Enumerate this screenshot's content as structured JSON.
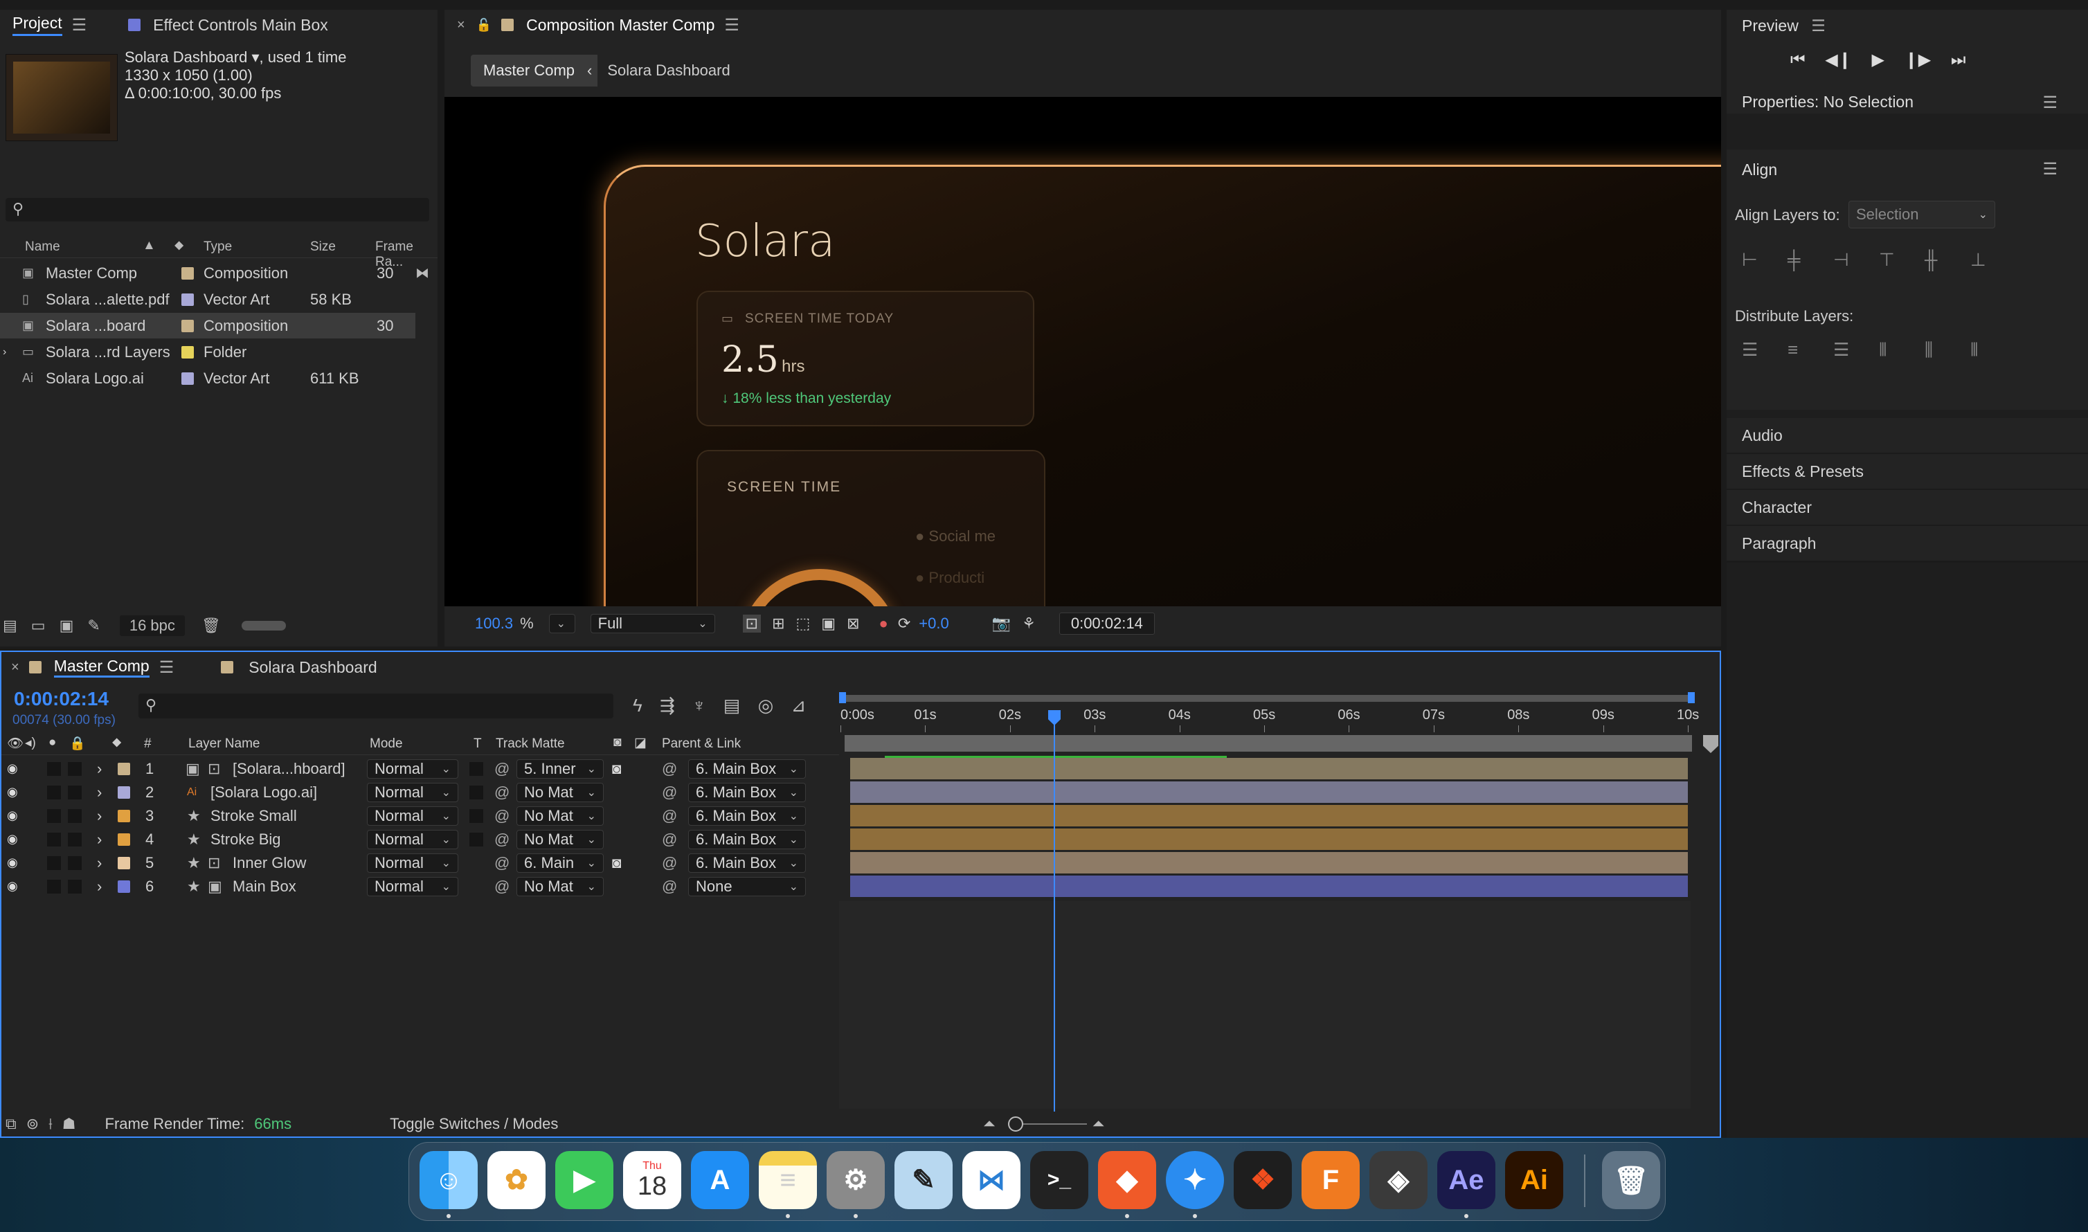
{
  "project_panel": {
    "tab_project": "Project",
    "tab_effects": "Effect Controls Main Box",
    "preview_name": "Solara Dashboard ▾",
    "preview_used": ", used 1 time",
    "preview_size": "1330 x 1050 (1.00)",
    "preview_duration": "Δ 0:00:10:00, 30.00 fps",
    "search_placeholder": "",
    "columns": {
      "name": "Name",
      "type": "Type",
      "size": "Size",
      "frame_rate": "Frame Ra..."
    },
    "items": [
      {
        "name": "Master Comp",
        "type": "Composition",
        "size": "",
        "fps": "30",
        "icon": "composition-icon",
        "color": "#c8b28a"
      },
      {
        "name": "Solara ...alette.pdf",
        "type": "Vector Art",
        "size": "58 KB",
        "fps": "",
        "icon": "file-icon",
        "color": "#a9a9d8"
      },
      {
        "name": "Solara ...board",
        "type": "Composition",
        "size": "",
        "fps": "30",
        "icon": "composition-icon",
        "color": "#c8b28a"
      },
      {
        "name": "Solara ...rd Layers",
        "type": "Folder",
        "size": "",
        "fps": "",
        "icon": "folder-icon",
        "color": "#e6d35a"
      },
      {
        "name": "Solara Logo.ai",
        "type": "Vector Art",
        "size": "611 KB",
        "fps": "",
        "icon": "ai-file-icon",
        "color": "#a9a9d8"
      }
    ],
    "bpc": "16 bpc"
  },
  "comp_viewer": {
    "tab_title": "Composition Master Comp",
    "breadcrumb_active": "Master Comp",
    "breadcrumb_next": "Solara Dashboard",
    "canvas": {
      "logo_text": "Solara",
      "card1_label": "SCREEN TIME TODAY",
      "card1_value": "2.5",
      "card1_unit": "hrs",
      "card1_delta": "↓ 18% less than yesterday",
      "card2_label": "SCREEN TIME",
      "legend1": "Social me",
      "legend2": "Producti"
    },
    "zoom": "100.3",
    "zoom_unit": "%",
    "resolution": "Full",
    "exposure": "+0.0",
    "timecode": "0:00:02:14"
  },
  "right_panel": {
    "preview": "Preview",
    "properties": "Properties: No Selection",
    "align": "Align",
    "align_layers_to": "Align Layers to:",
    "align_target": "Selection",
    "distribute": "Distribute Layers:",
    "sections": [
      "Audio",
      "Effects & Presets",
      "Character",
      "Paragraph"
    ]
  },
  "timeline": {
    "tab_master": "Master Comp",
    "tab_solara": "Solara Dashboard",
    "timecode": "0:00:02:14",
    "frames": "00074 (30.00 fps)",
    "columns": {
      "num": "#",
      "layer_name": "Layer Name",
      "mode": "Mode",
      "t": "T",
      "track_matte": "Track Matte",
      "parent": "Parent & Link"
    },
    "ruler": [
      "0:00s",
      "01s",
      "02s",
      "03s",
      "04s",
      "05s",
      "06s",
      "07s",
      "08s",
      "09s",
      "10s"
    ],
    "layers": [
      {
        "num": "1",
        "name": "[Solara...hboard]",
        "mode": "Normal",
        "matte": "5. Inner",
        "parent": "6. Main Box",
        "color": "#c8b28a",
        "bar": "#857960"
      },
      {
        "num": "2",
        "name": "[Solara Logo.ai]",
        "mode": "Normal",
        "matte": "No Mat",
        "parent": "6. Main Box",
        "color": "#a9a9d8",
        "bar": "#77778f"
      },
      {
        "num": "3",
        "name": "Stroke Small",
        "mode": "Normal",
        "matte": "No Mat",
        "parent": "6. Main Box",
        "color": "#e0a040",
        "bar": "#8f6e3b"
      },
      {
        "num": "4",
        "name": "Stroke Big",
        "mode": "Normal",
        "matte": "No Mat",
        "parent": "6. Main Box",
        "color": "#e0a040",
        "bar": "#8f6e3b"
      },
      {
        "num": "5",
        "name": "Inner Glow",
        "mode": "Normal",
        "matte": "6. Main",
        "parent": "6. Main Box",
        "color": "#e8c8a0",
        "bar": "#8e7b66"
      },
      {
        "num": "6",
        "name": "Main Box",
        "mode": "Normal",
        "matte": "No Mat",
        "parent": "None",
        "color": "#6f78d8",
        "bar": "#53579c"
      }
    ],
    "frame_render_label": "Frame Render Time:",
    "frame_render_value": "66ms",
    "toggle_label": "Toggle Switches / Modes"
  },
  "dock": {
    "calendar_day": "Thu",
    "calendar_date": "18",
    "apps": [
      "finder-icon",
      "photos-icon",
      "facetime-icon",
      "calendar-icon",
      "app-store-icon",
      "notes-icon",
      "system-settings-icon",
      "reader-icon",
      "vscode-icon",
      "terminal-icon",
      "brave-icon",
      "safari-icon",
      "figma-icon",
      "fusion-icon",
      "cube-icon",
      "after-effects-icon",
      "illustrator-icon",
      "trash-icon"
    ],
    "ae_label": "Ae",
    "ai_label": "Ai",
    "fus_label": "F",
    "terminal_label": ">_"
  }
}
